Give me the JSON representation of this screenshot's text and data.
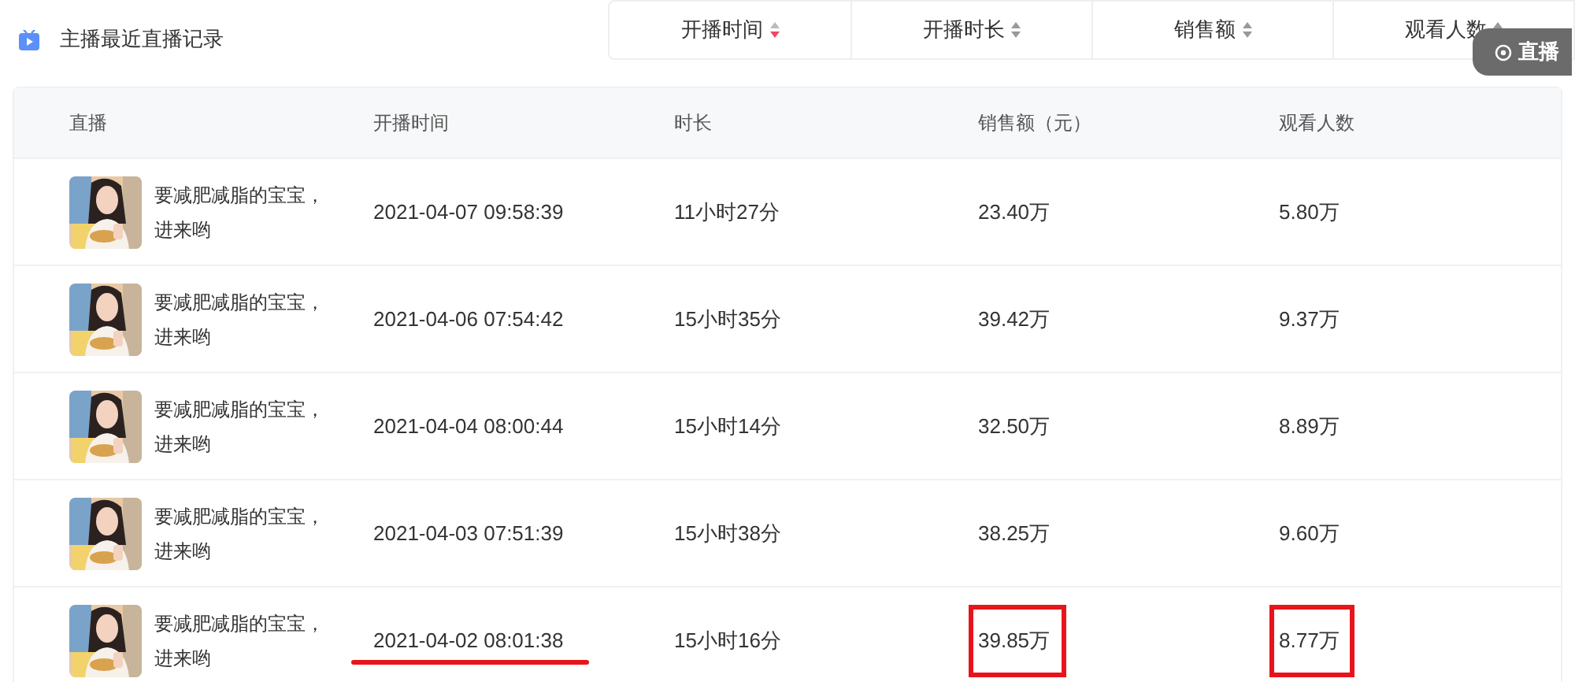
{
  "header": {
    "title": "主播最近直播记录"
  },
  "sort_tabs": [
    {
      "label": "开播时间",
      "selected": true
    },
    {
      "label": "开播时长",
      "selected": false
    },
    {
      "label": "销售额",
      "selected": false
    },
    {
      "label": "观看人数",
      "selected": false
    }
  ],
  "overlay_button": {
    "label": "直播"
  },
  "table": {
    "columns": [
      "直播",
      "开播时间",
      "时长",
      "销售额（元）",
      "观看人数"
    ],
    "rows": [
      {
        "title": "要减肥减脂的宝宝，进来哟",
        "start_time": "2021-04-07 09:58:39",
        "duration": "11小时27分",
        "sales": "23.40万",
        "viewers": "5.80万",
        "marked": false
      },
      {
        "title": "要减肥减脂的宝宝，进来哟",
        "start_time": "2021-04-06 07:54:42",
        "duration": "15小时35分",
        "sales": "39.42万",
        "viewers": "9.37万",
        "marked": false
      },
      {
        "title": "要减肥减脂的宝宝，进来哟",
        "start_time": "2021-04-04 08:00:44",
        "duration": "15小时14分",
        "sales": "32.50万",
        "viewers": "8.89万",
        "marked": false
      },
      {
        "title": "要减肥减脂的宝宝，进来哟",
        "start_time": "2021-04-03 07:51:39",
        "duration": "15小时38分",
        "sales": "38.25万",
        "viewers": "9.60万",
        "marked": false
      },
      {
        "title": "要减肥减脂的宝宝，进来哟",
        "start_time": "2021-04-02 08:01:38",
        "duration": "15小时16分",
        "sales": "39.85万",
        "viewers": "8.77万",
        "marked": true
      }
    ]
  }
}
